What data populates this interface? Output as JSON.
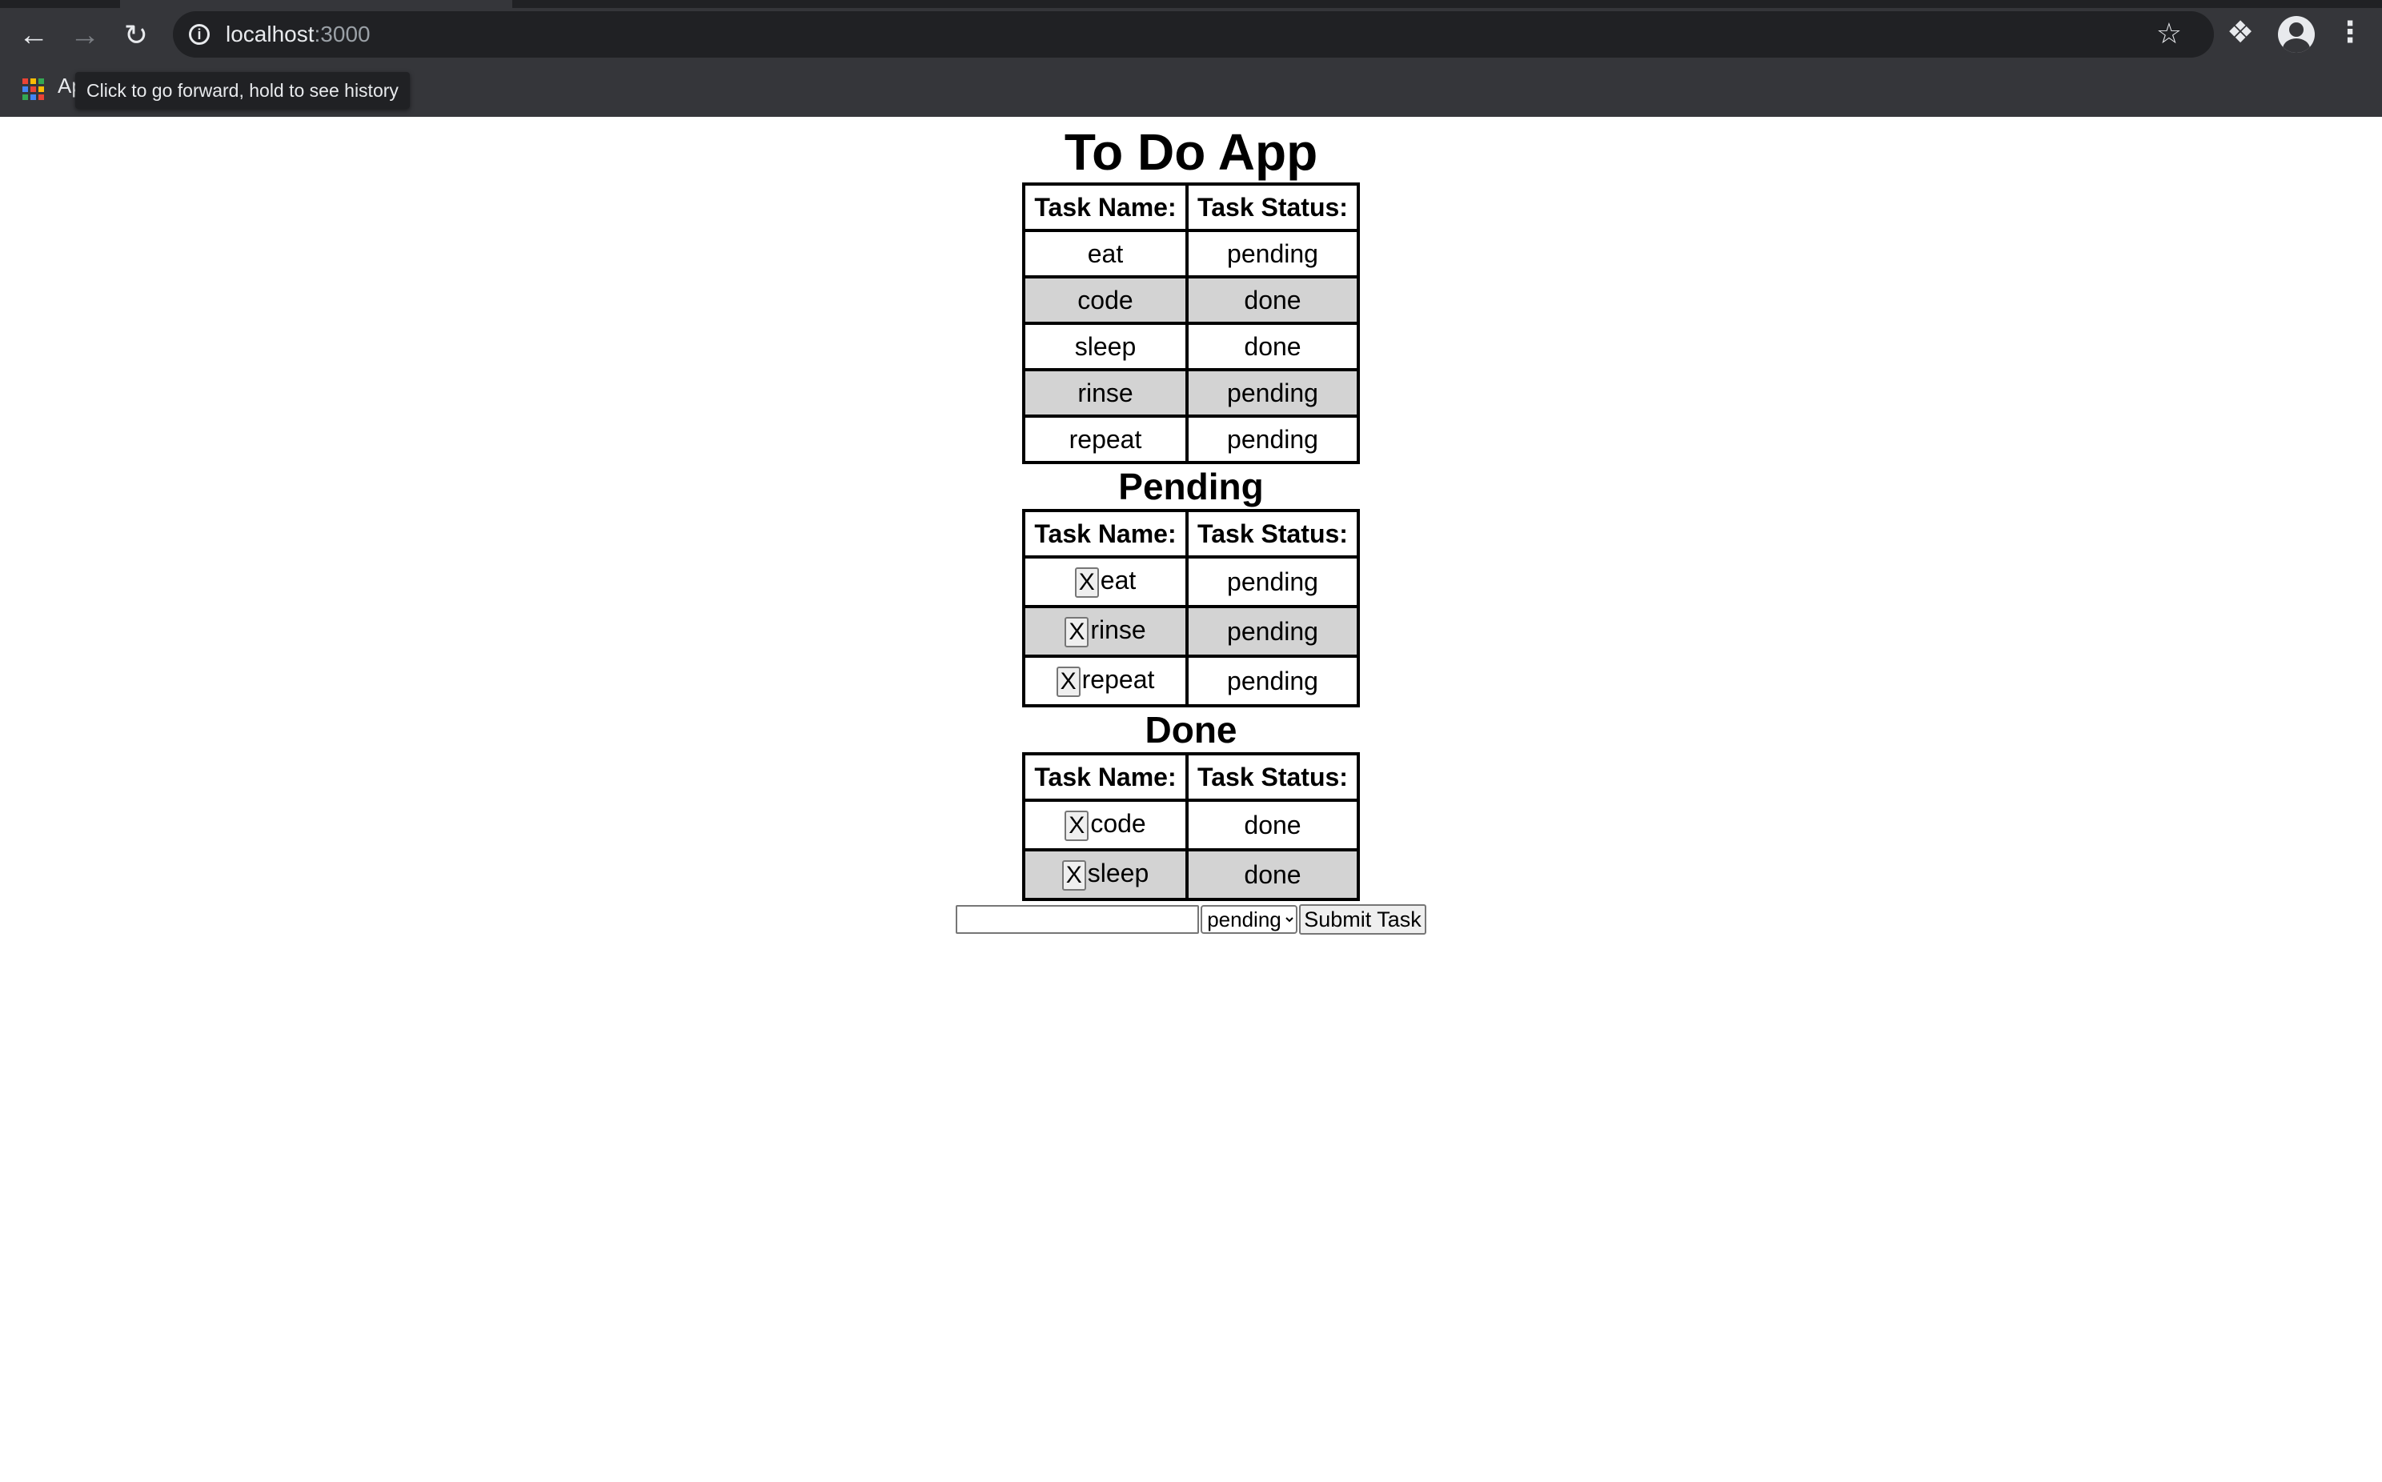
{
  "browser": {
    "url_host": "localhost",
    "url_port": ":3000",
    "tooltip": "Click to go forward, hold to see history",
    "apps_label": "Ap",
    "apps_colors": [
      "#ea4335",
      "#fbbc05",
      "#34a853",
      "#4285f4",
      "#ea4335",
      "#fbbc05",
      "#34a853",
      "#4285f4",
      "#ea4335"
    ]
  },
  "app": {
    "title": "To Do App",
    "col_name": "Task Name:",
    "col_status": "Task Status:",
    "all_tasks": [
      {
        "name": "eat",
        "status": "pending"
      },
      {
        "name": "code",
        "status": "done"
      },
      {
        "name": "sleep",
        "status": "done"
      },
      {
        "name": "rinse",
        "status": "pending"
      },
      {
        "name": "repeat",
        "status": "pending"
      }
    ],
    "pending_heading": "Pending",
    "pending_tasks": [
      {
        "x": "X",
        "name": "eat",
        "status": "pending"
      },
      {
        "x": "X",
        "name": "rinse",
        "status": "pending"
      },
      {
        "x": "X",
        "name": "repeat",
        "status": "pending"
      }
    ],
    "done_heading": "Done",
    "done_tasks": [
      {
        "x": "X",
        "name": "code",
        "status": "done"
      },
      {
        "x": "X",
        "name": "sleep",
        "status": "done"
      }
    ],
    "form": {
      "input_value": "",
      "select_value": "pending",
      "submit_label": "Submit Task"
    }
  }
}
